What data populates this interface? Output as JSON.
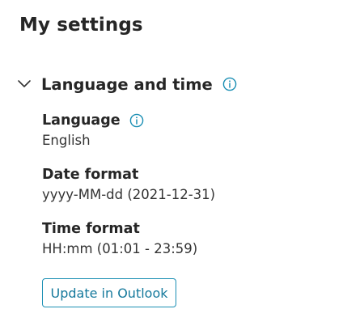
{
  "page": {
    "title": "My settings"
  },
  "section": {
    "title": "Language and time",
    "expanded": true,
    "chevron_icon": "chevron-down-icon",
    "info_icon": "info-icon"
  },
  "fields": {
    "language": {
      "label": "Language",
      "value": "English",
      "info_icon": "info-icon"
    },
    "date_format": {
      "label": "Date format",
      "value": "yyyy-MM-dd (2021-12-31)"
    },
    "time_format": {
      "label": "Time format",
      "value": "HH:mm (01:01 - 23:59)"
    }
  },
  "actions": {
    "update_label": "Update in Outlook"
  },
  "colors": {
    "accent": "#1b8fb4",
    "text": "#262626"
  }
}
